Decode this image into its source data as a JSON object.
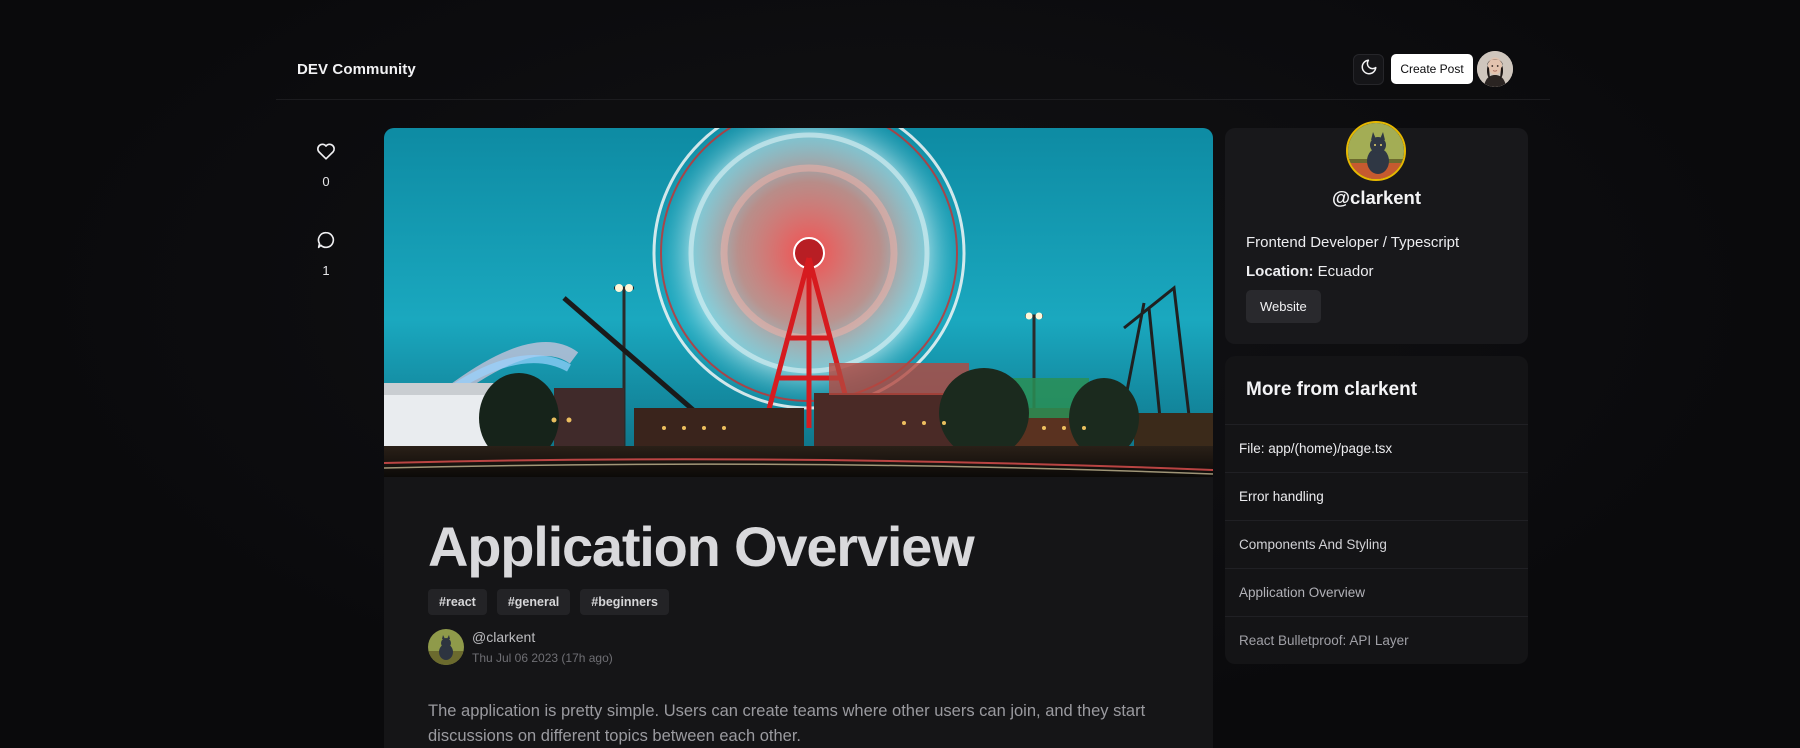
{
  "header": {
    "brand": "DEV Community",
    "theme_icon": "moon-icon",
    "create_post_label": "Create Post",
    "avatar_icon": "user-avatar"
  },
  "reactions": {
    "likes_icon": "heart-icon",
    "likes_count": "0",
    "comments_icon": "comment-icon",
    "comments_count": "1"
  },
  "article": {
    "cover_alt": "ferris-wheel-cover-image",
    "title": "Application Overview",
    "tags": [
      "#react",
      "#general",
      "#beginners"
    ],
    "author": "@clarkent",
    "date": "Thu Jul 06 2023 (17h ago)",
    "intro": "The application is pretty simple. Users can create teams where other users can join, and they start discussions on different topics between each other."
  },
  "profile": {
    "handle": "@clarkent",
    "bio": "Frontend Developer / Typescript",
    "location_label": "Location:",
    "location_value": "Ecuador",
    "website_label": "Website"
  },
  "more_from": {
    "title": "More from clarkent",
    "items": [
      "File: app/(home)/page.tsx",
      "Error handling",
      "Components And Styling",
      "Application Overview",
      "React Bulletproof: API Layer"
    ],
    "item_colors": [
      "#ededf0",
      "#ededf0",
      "#d2d2d6",
      "#b2b2b8",
      "#a0a0a6"
    ]
  },
  "colors": {
    "background": "#0a0a0c",
    "card": "#151517",
    "accent_white": "#ffffff"
  }
}
